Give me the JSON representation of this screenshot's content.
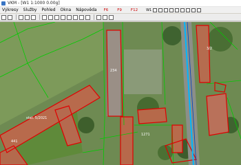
{
  "window": {
    "title": "VKM - [W1 1:1000 0.00g]"
  },
  "menu": {
    "items": [
      "Výkresy",
      "Služby",
      "Pohled",
      "Okna",
      "Nápověda"
    ],
    "function_keys": [
      "F6",
      "F9",
      "F12"
    ],
    "scale_label": "W1"
  },
  "map": {
    "labels": [
      {
        "text": "stat. 5/2021",
        "name": "map-label-parcel-bottom"
      },
      {
        "text": "234",
        "name": "map-label-parcel-1"
      },
      {
        "text": "1271",
        "name": "map-label-parcel-2"
      },
      {
        "text": "3/2",
        "name": "map-label-parcel-3"
      },
      {
        "text": "441",
        "name": "map-label-parcel-4"
      }
    ],
    "colors": {
      "parcel_line": "#00cc00",
      "building_outline": "#e00000",
      "road_line": "#00b7ff",
      "road_accent": "#0040c0"
    }
  }
}
